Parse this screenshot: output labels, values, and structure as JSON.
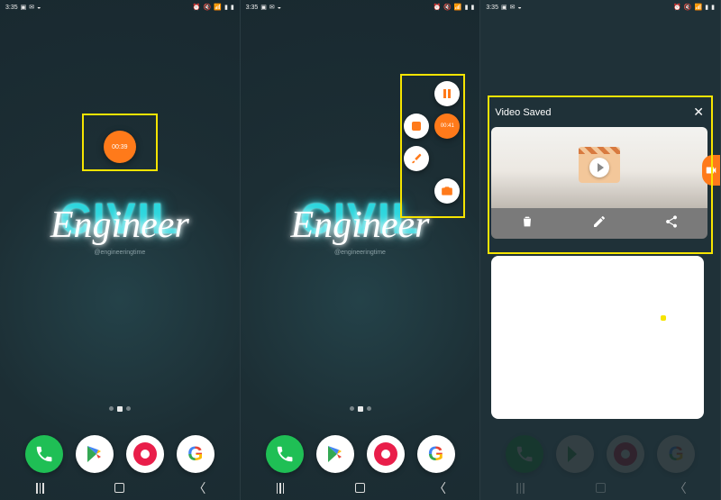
{
  "panels": [
    {
      "time": "3:35",
      "wallpaper": {
        "big_word": "CIVIL",
        "script_word": "Engineer",
        "credit": "@engineeringtime"
      },
      "rec_timer": "00:39"
    },
    {
      "time": "3:35",
      "wallpaper": {
        "big_word": "CIVIL",
        "script_word": "Engineer",
        "credit": "@engineeringtime"
      },
      "rec_timer": "00:41"
    },
    {
      "time": "3:35",
      "saved": {
        "title": "Video Saved"
      }
    }
  ],
  "tool_buttons": {
    "pause": "pause",
    "stop": "stop",
    "brush": "brush",
    "camera": "camera"
  },
  "saved_actions": {
    "delete": "delete-icon",
    "edit": "edit-icon",
    "share": "share-icon"
  },
  "dock": {
    "phone": "phone-app",
    "play": "play-store-app",
    "recorder": "screen-recorder-app",
    "google": "google-app",
    "g_letter": "G"
  },
  "nav": {
    "recents": "recents",
    "home": "home",
    "back": "back"
  }
}
